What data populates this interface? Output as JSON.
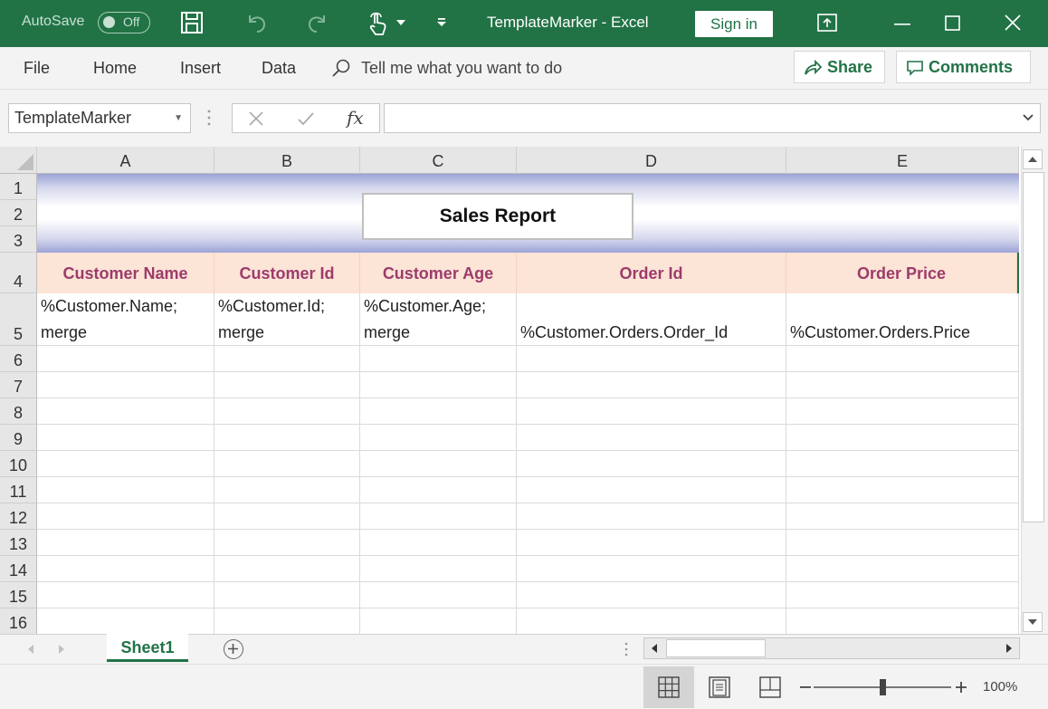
{
  "titlebar": {
    "autosave_label": "AutoSave",
    "autosave_state": "Off",
    "window_title": "TemplateMarker  -  Excel",
    "signin_label": "Sign in"
  },
  "ribbon": {
    "tabs": [
      "File",
      "Home",
      "Insert",
      "Data"
    ],
    "tellme": "Tell me what you want to do",
    "share_label": "Share",
    "comments_label": "Comments"
  },
  "formula_bar": {
    "name_box": "TemplateMarker",
    "fx_label": "fx",
    "formula_value": ""
  },
  "grid": {
    "columns": [
      "A",
      "B",
      "C",
      "D",
      "E"
    ],
    "rows": [
      "1",
      "2",
      "3",
      "4",
      "5",
      "6",
      "7",
      "8",
      "9",
      "10",
      "11",
      "12",
      "13",
      "14",
      "15",
      "16"
    ],
    "title": "Sales Report",
    "headers": [
      "Customer Name",
      "Customer Id",
      "Customer Age",
      "Order Id",
      "Order Price"
    ],
    "markers": [
      [
        "%Customer.Name;",
        "merge"
      ],
      [
        "%Customer.Id;",
        "merge"
      ],
      [
        "%Customer.Age;",
        "merge"
      ],
      [
        "",
        "%Customer.Orders.Order_Id"
      ],
      [
        "",
        "%Customer.Orders.Price"
      ]
    ]
  },
  "sheets": {
    "active": "Sheet1"
  },
  "statusbar": {
    "zoom": "100%",
    "zoom_level": 0.5
  },
  "colors": {
    "excel_green": "#217346",
    "header_fill": "#fce4d6",
    "header_text": "#9c3b6b",
    "banner_blue": "#9ca3d6"
  }
}
